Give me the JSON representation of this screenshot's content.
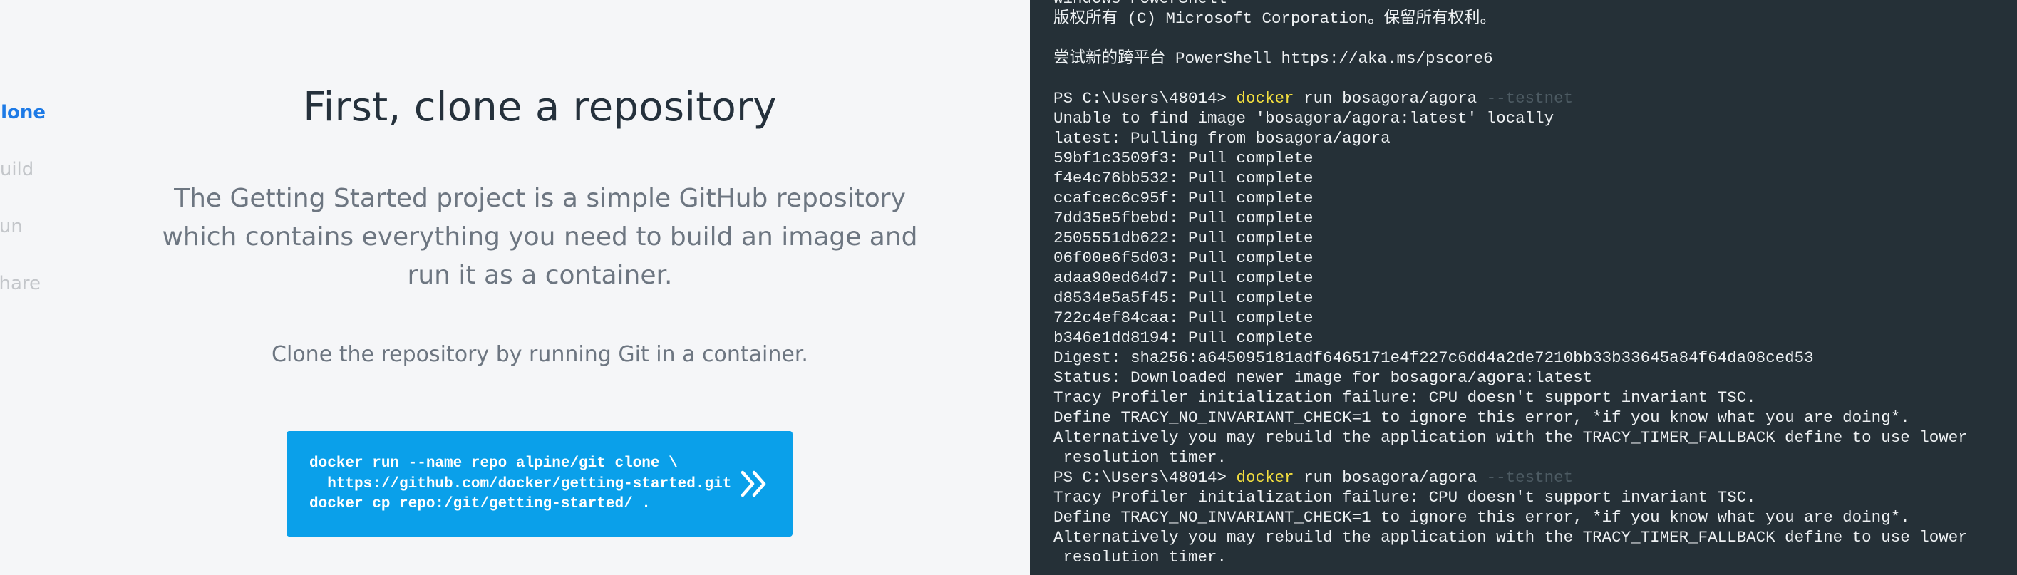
{
  "sidebar": {
    "steps": [
      {
        "label": "Clone",
        "active": true
      },
      {
        "label": "Build",
        "active": false
      },
      {
        "label": "Run",
        "active": false
      },
      {
        "label": "Share",
        "active": false
      }
    ]
  },
  "main": {
    "title": "First, clone a repository",
    "intro": "The Getting Started project is a simple GitHub repository which contains everything you need to build an image and run it as a container.",
    "instruction": "Clone the repository by running Git in a container.",
    "command_lines": [
      "docker run --name repo alpine/git clone \\",
      "  https://github.com/docker/getting-started.git",
      "docker cp repo:/git/getting-started/ ."
    ]
  },
  "terminal": {
    "header": "Windows PowerShell",
    "copyright": "版权所有 (C) Microsoft Corporation。保留所有权利。",
    "tip": "尝试新的跨平台 PowerShell https://aka.ms/pscore6",
    "prompt": "PS C:\\Users\\48014> ",
    "cmd_word": "docker",
    "cmd_args": " run bosagora/agora ",
    "cmd_flag": "--testnet",
    "output1": [
      "Unable to find image 'bosagora/agora:latest' locally",
      "latest: Pulling from bosagora/agora",
      "59bf1c3509f3: Pull complete",
      "f4e4c76bb532: Pull complete",
      "ccafcec6c95f: Pull complete",
      "7dd35e5fbebd: Pull complete",
      "2505551db622: Pull complete",
      "06f00e6f5d03: Pull complete",
      "adaa90ed64d7: Pull complete",
      "d8534e5a5f45: Pull complete",
      "722c4ef84caa: Pull complete",
      "b346e1dd8194: Pull complete",
      "Digest: sha256:a645095181adf6465171e4f227c6dd4a2de7210bb33b33645a84f64da08ced53",
      "Status: Downloaded newer image for bosagora/agora:latest",
      "Tracy Profiler initialization failure: CPU doesn't support invariant TSC.",
      "Define TRACY_NO_INVARIANT_CHECK=1 to ignore this error, *if you know what you are doing*.",
      "Alternatively you may rebuild the application with the TRACY_TIMER_FALLBACK define to use lower",
      " resolution timer."
    ],
    "output2": [
      "Tracy Profiler initialization failure: CPU doesn't support invariant TSC.",
      "Define TRACY_NO_INVARIANT_CHECK=1 to ignore this error, *if you know what you are doing*.",
      "Alternatively you may rebuild the application with the TRACY_TIMER_FALLBACK define to use lower",
      " resolution timer."
    ]
  },
  "colors": {
    "accent": "#1d7ae6",
    "button": "#0aa0ea",
    "terminal_bg": "#253037",
    "command_highlight": "#f3df3f"
  },
  "icons": {
    "run": "double-chevron-right-icon"
  }
}
